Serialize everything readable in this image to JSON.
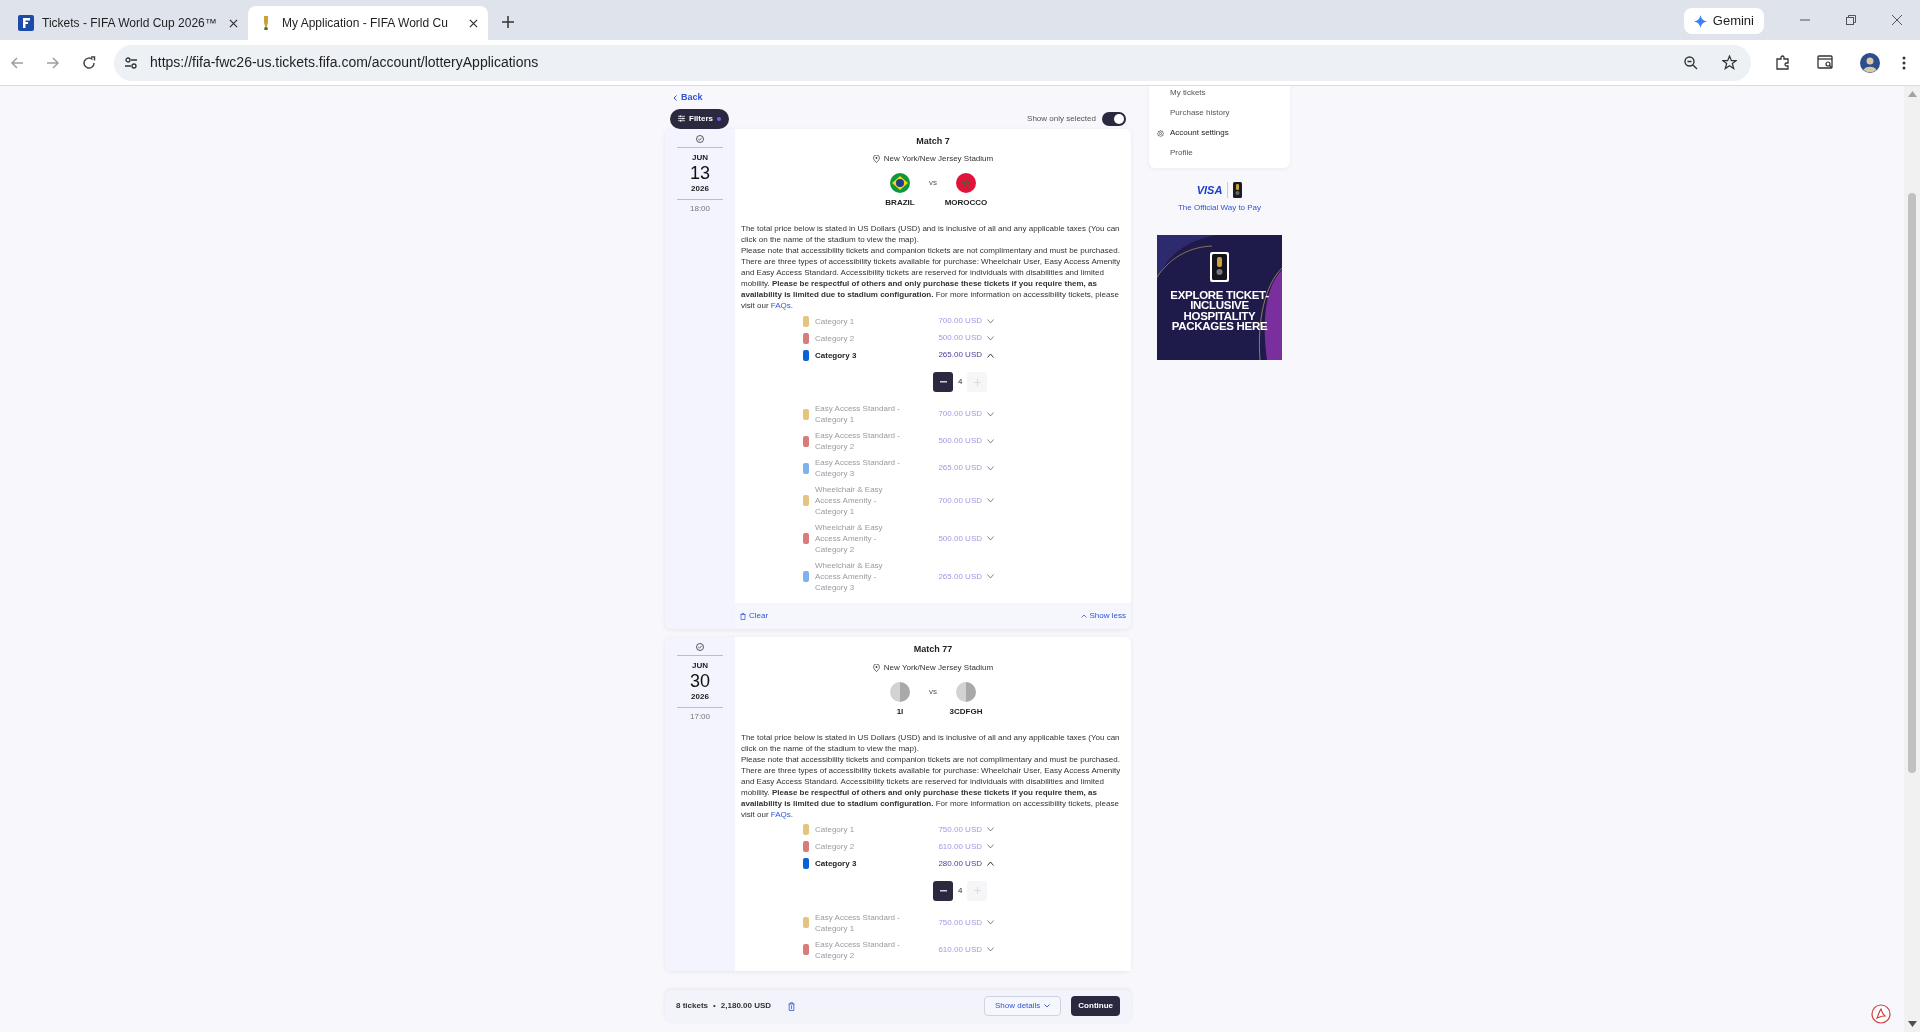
{
  "browser": {
    "tabs": [
      {
        "title": "Tickets - FIFA World Cup 2026™",
        "selected": false,
        "kind": "square"
      },
      {
        "title": "My Application - FIFA World Cu",
        "selected": true,
        "kind": "trophy"
      }
    ],
    "gemini": "Gemini",
    "url": "https://fifa-fwc26-us.tickets.fifa.com/account/lotteryApplications"
  },
  "page": {
    "back": "Back",
    "filters": "Filters",
    "show_only_selected": {
      "label": "Show only selected",
      "on": true
    }
  },
  "matches": [
    {
      "title": "Match 7",
      "venue": "New York/New Jersey Stadium",
      "month": "JUN",
      "day": "13",
      "year": "2026",
      "time": "18:00",
      "versus": "vs",
      "teams": [
        {
          "name": "BRAZIL",
          "kind": "brazil"
        },
        {
          "name": "MOROCCO",
          "kind": "morocco"
        }
      ],
      "notice_intro": "The total price below is stated in US Dollars (USD) and is inclusive of all and any applicable taxes (You can click on the name of the stadium to view the map).",
      "notice_detail": "Please note that accessibility tickets and companion tickets are not complimentary and must be purchased. There are three types of accessibility tickets available for purchase: Wheelchair User, Easy Access Amenity and Easy Access Standard. Accessibility tickets are reserved for individuals with disabilities and limited mobility. **Please be respectful of others and only purchase these tickets if you require them, as availability is limited due to stadium configuration.** For more information on accessibility tickets, please visit our ",
      "notice_link": "FAQs",
      "notice_end": ".",
      "categories": [
        {
          "name": "Category 1",
          "price": "700.00 USD",
          "color": "#e4c47f",
          "expanded": false
        },
        {
          "name": "Category 2",
          "price": "500.00 USD",
          "color": "#d97b7b",
          "expanded": false
        },
        {
          "name": "Category 3",
          "price": "265.00 USD",
          "color": "#0b62d8",
          "expanded": true,
          "quantity": "4"
        },
        {
          "name": "Easy Access Standard - Category 1",
          "price": "700.00 USD",
          "color": "#e4c47f",
          "expanded": false
        },
        {
          "name": "Easy Access Standard - Category 2",
          "price": "500.00 USD",
          "color": "#d97b7b",
          "expanded": false
        },
        {
          "name": "Easy Access Standard - Category 3",
          "price": "265.00 USD",
          "color": "#7fb2ec",
          "expanded": false
        },
        {
          "name": "Wheelchair & Easy Access Amenity - Category 1",
          "price": "700.00 USD",
          "color": "#e4c47f",
          "expanded": false
        },
        {
          "name": "Wheelchair & Easy Access Amenity - Category 2",
          "price": "500.00 USD",
          "color": "#d97b7b",
          "expanded": false
        },
        {
          "name": "Wheelchair & Easy Access Amenity - Category 3",
          "price": "265.00 USD",
          "color": "#7fb2ec",
          "expanded": false
        }
      ],
      "footer": {
        "clear": "Clear",
        "toggle": "Show less"
      }
    },
    {
      "title": "Match 77",
      "venue": "New York/New Jersey Stadium",
      "month": "JUN",
      "day": "30",
      "year": "2026",
      "time": "17:00",
      "versus": "vs",
      "teams": [
        {
          "name": "1I",
          "kind": "placeholder"
        },
        {
          "name": "3CDFGH",
          "kind": "placeholder"
        }
      ],
      "notice_intro": "The total price below is stated in US Dollars (USD) and is inclusive of all and any applicable taxes (You can click on the name of the stadium to view the map).",
      "notice_detail": "Please note that accessibility tickets and companion tickets are not complimentary and must be purchased. There are three types of accessibility tickets available for purchase: Wheelchair User, Easy Access Amenity and Easy Access Standard. Accessibility tickets are reserved for individuals with disabilities and limited mobility. **Please be respectful of others and only purchase these tickets if you require them, as availability is limited due to stadium configuration.** For more information on accessibility tickets, please visit our ",
      "notice_link": "FAQs",
      "notice_end": ".",
      "categories": [
        {
          "name": "Category 1",
          "price": "750.00 USD",
          "color": "#e4c47f",
          "expanded": false
        },
        {
          "name": "Category 2",
          "price": "610.00 USD",
          "color": "#d97b7b",
          "expanded": false
        },
        {
          "name": "Category 3",
          "price": "280.00 USD",
          "color": "#0b62d8",
          "expanded": true,
          "quantity": "4"
        },
        {
          "name": "Easy Access Standard - Category 1",
          "price": "750.00 USD",
          "color": "#e4c47f",
          "expanded": false
        },
        {
          "name": "Easy Access Standard - Category 2",
          "price": "610.00 USD",
          "color": "#d97b7b",
          "expanded": false
        }
      ]
    }
  ],
  "summary": {
    "tickets": "8 tickets",
    "separator": "•",
    "total": "2,180.00 USD",
    "show_details": "Show details",
    "continue": "Continue"
  },
  "account_menu": [
    {
      "label": "My tickets",
      "kind": "link"
    },
    {
      "label": "Purchase history",
      "kind": "link"
    },
    {
      "label": "Account settings",
      "kind": "section"
    },
    {
      "label": "Profile",
      "kind": "link"
    }
  ],
  "sponsor": {
    "logo": "VISA",
    "tagline": "The Official Way to Pay"
  },
  "promo": {
    "text": "EXPLORE TICKET-INCLUSIVE HOSPITALITY PACKAGES HERE"
  }
}
